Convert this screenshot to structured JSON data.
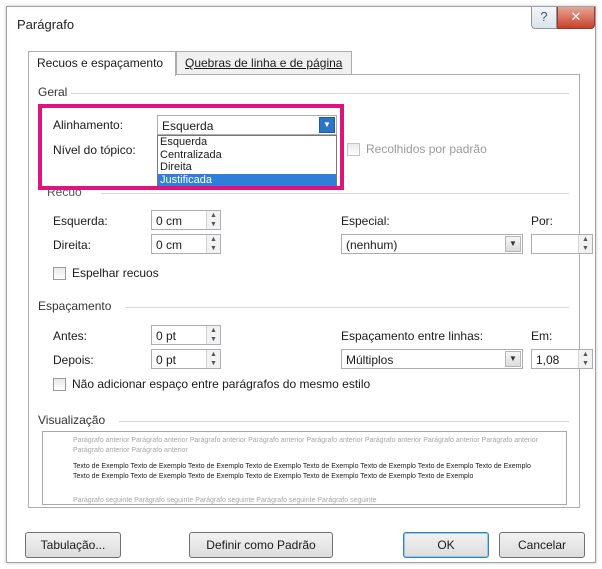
{
  "window": {
    "title": "Parágrafo",
    "help_glyph": "?",
    "close_glyph": "✕"
  },
  "tabs": [
    {
      "label": "Recuos e espaçamento",
      "active": true
    },
    {
      "label": "Quebras de linha e de página",
      "active": false
    }
  ],
  "geral": {
    "section": "Geral",
    "alinhamento_label": "Alinhamento:",
    "alinhamento_value": "Esquerda",
    "alinhamento_options": [
      "Esquerda",
      "Centralizada",
      "Direita",
      "Justificada"
    ],
    "alinhamento_selected_option": "Justificada",
    "nivel_label": "Nível do tópico:",
    "recolhidos_label": "Recolhidos por padrão"
  },
  "recuo": {
    "section": "Recuo",
    "esquerda_label": "Esquerda:",
    "esquerda_value": "0 cm",
    "direita_label": "Direita:",
    "direita_value": "0 cm",
    "especial_label": "Especial:",
    "especial_value": "(nenhum)",
    "por_label": "Por:",
    "por_value": "",
    "espelhar_label": "Espelhar recuos"
  },
  "espacamento": {
    "section": "Espaçamento",
    "antes_label": "Antes:",
    "antes_value": "0 pt",
    "depois_label": "Depois:",
    "depois_value": "0 pt",
    "entre_linhas_label": "Espaçamento entre linhas:",
    "entre_linhas_value": "Múltiplos",
    "em_label": "Em:",
    "em_value": "1,08",
    "nao_adicionar_label": "Não adicionar espaço entre parágrafos do mesmo estilo"
  },
  "visualizacao": {
    "section": "Visualização",
    "previous_text": "Parágrafo anterior Parágrafo anterior Parágrafo anterior Parágrafo anterior Parágrafo anterior Parágrafo anterior Parágrafo anterior Parágrafo anterior Parágrafo anterior Parágrafo anterior",
    "sample_text": "Texto de Exemplo Texto de Exemplo Texto de Exemplo Texto de Exemplo Texto de Exemplo Texto de Exemplo Texto de Exemplo Texto de Exemplo Texto de Exemplo Texto de Exemplo Texto de Exemplo Texto de Exemplo Texto de Exemplo Texto de Exemplo Texto de Exemplo",
    "next_text": "Parágrafo seguinte Parágrafo seguinte Parágrafo seguinte Parágrafo seguinte Parágrafo seguinte"
  },
  "buttons": {
    "tabulacao": "Tabulação...",
    "definir_padrao": "Definir como Padrão",
    "ok": "OK",
    "cancelar": "Cancelar"
  },
  "colors": {
    "highlight": "#e0127d",
    "selection": "#2f7fd9"
  },
  "icons": {
    "spin_up": "▲",
    "spin_down": "▼",
    "combo_arrow": "▼"
  }
}
